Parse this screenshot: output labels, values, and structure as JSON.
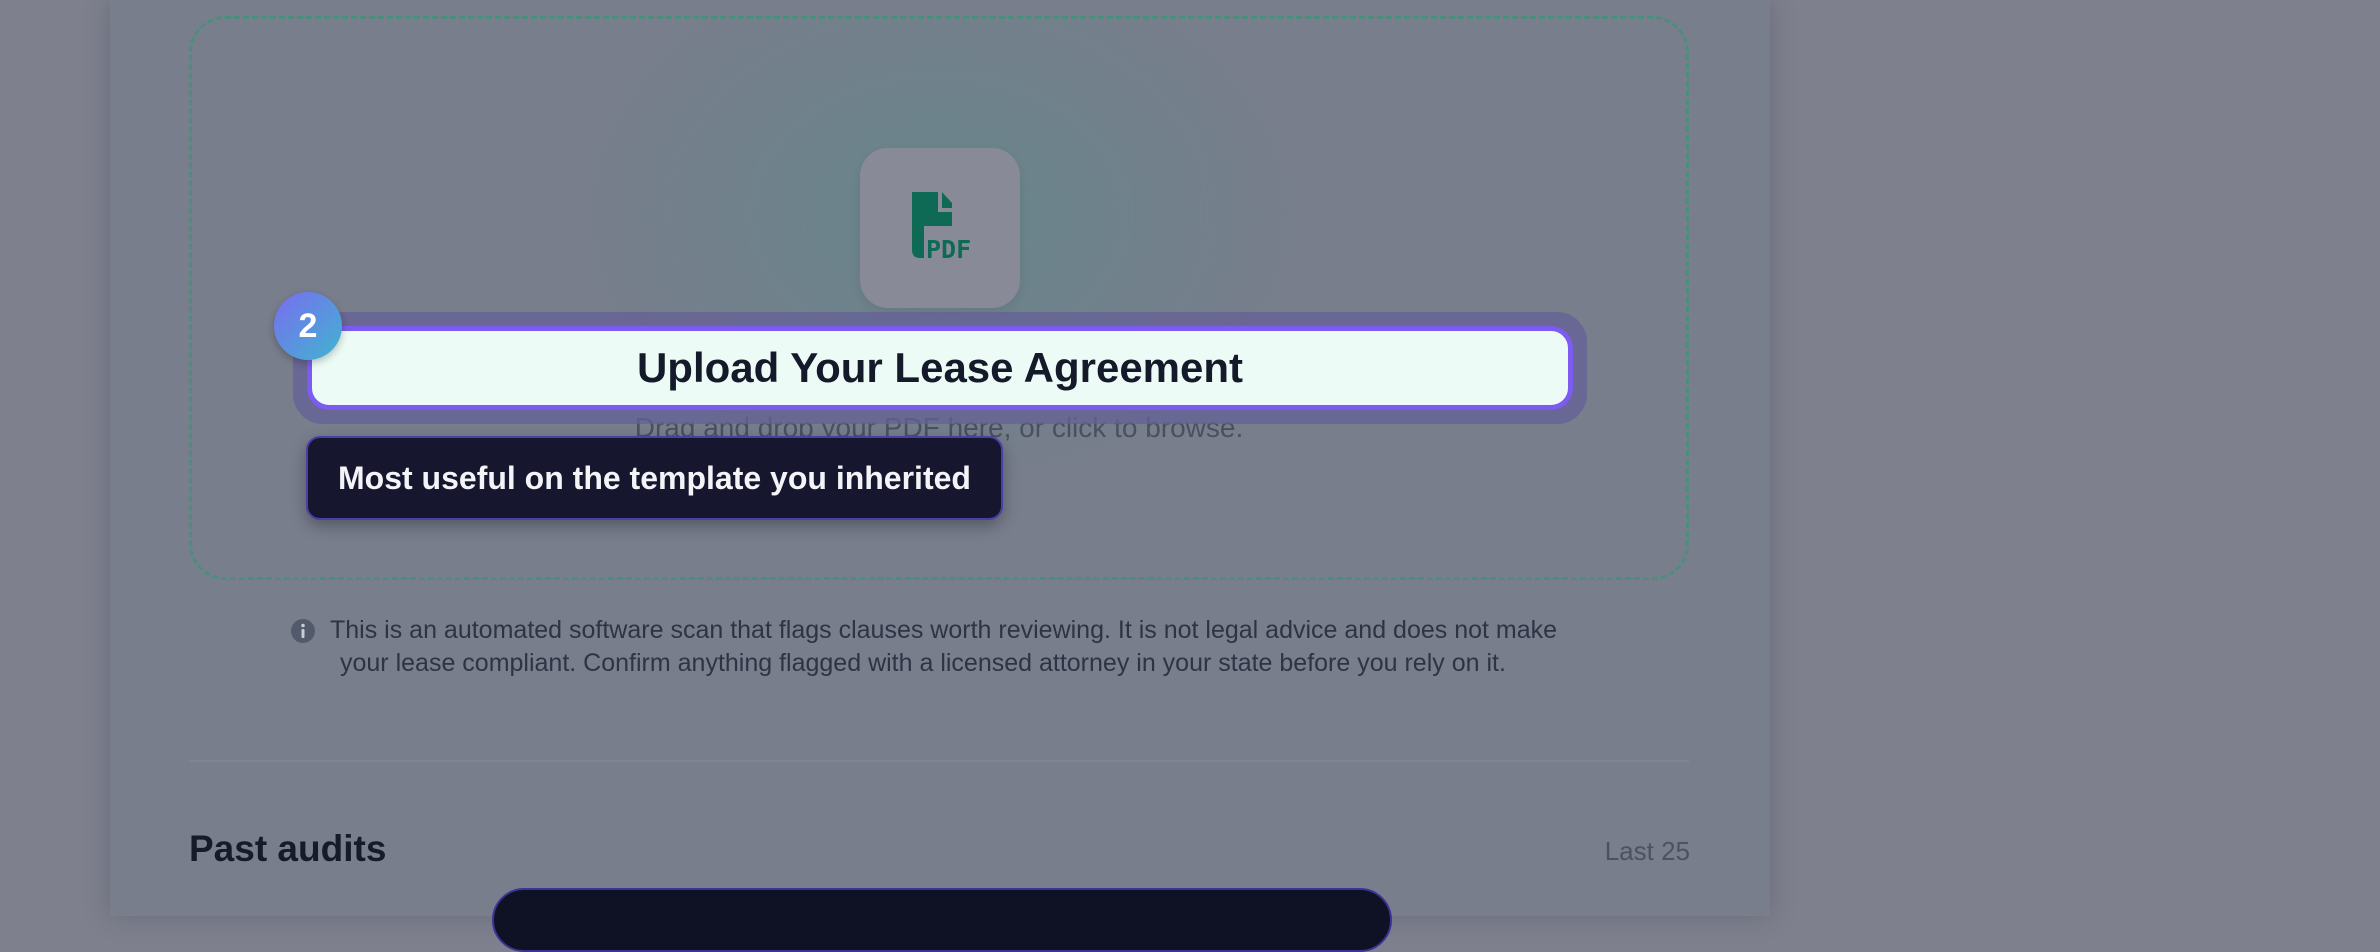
{
  "upload": {
    "icon": "pdf-file-icon",
    "icon_label": "PDF",
    "title": "Upload Your Lease Agreement",
    "subtext": "Drag and drop your PDF here, or click to browse."
  },
  "tour": {
    "step_number": "2",
    "tooltip": "Most useful on the template you inherited"
  },
  "disclaimer": {
    "icon": "info-icon",
    "line1": "This is an automated software scan that flags clauses worth reviewing. It is not legal advice and does not make",
    "line2": "your lease compliant. Confirm anything flagged with a licensed attorney in your state before you rely on it."
  },
  "past_audits": {
    "title": "Past audits",
    "count_label": "Last 25"
  },
  "colors": {
    "accent": "#7c5cf0",
    "brand_green": "#0f6a55",
    "dropzone_border": "#4a8f7e",
    "tooltip_bg": "#16172e"
  }
}
